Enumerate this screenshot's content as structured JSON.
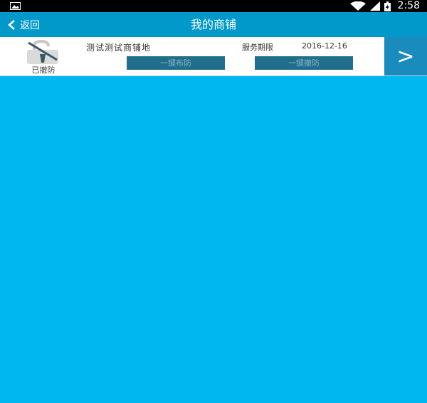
{
  "statusbar": {
    "time": "2:58",
    "icons": [
      "image-icon",
      "wifi-icon",
      "signal-icon",
      "battery-charging-icon"
    ]
  },
  "navbar": {
    "back_label": "返回",
    "title": "我的商铺"
  },
  "shop": {
    "name": "测试测试商铺地",
    "service_label": "服务期限",
    "service_date": "2016-12-16",
    "lock_status": "已撤防",
    "arm_button": "一键布防",
    "disarm_button": "一键撤防",
    "detail_arrow": ">"
  },
  "colors": {
    "background": "#00b7ef",
    "navbar": "#0099c9",
    "button": "#1e6e8c",
    "arrow_panel": "#1a8bbd"
  }
}
